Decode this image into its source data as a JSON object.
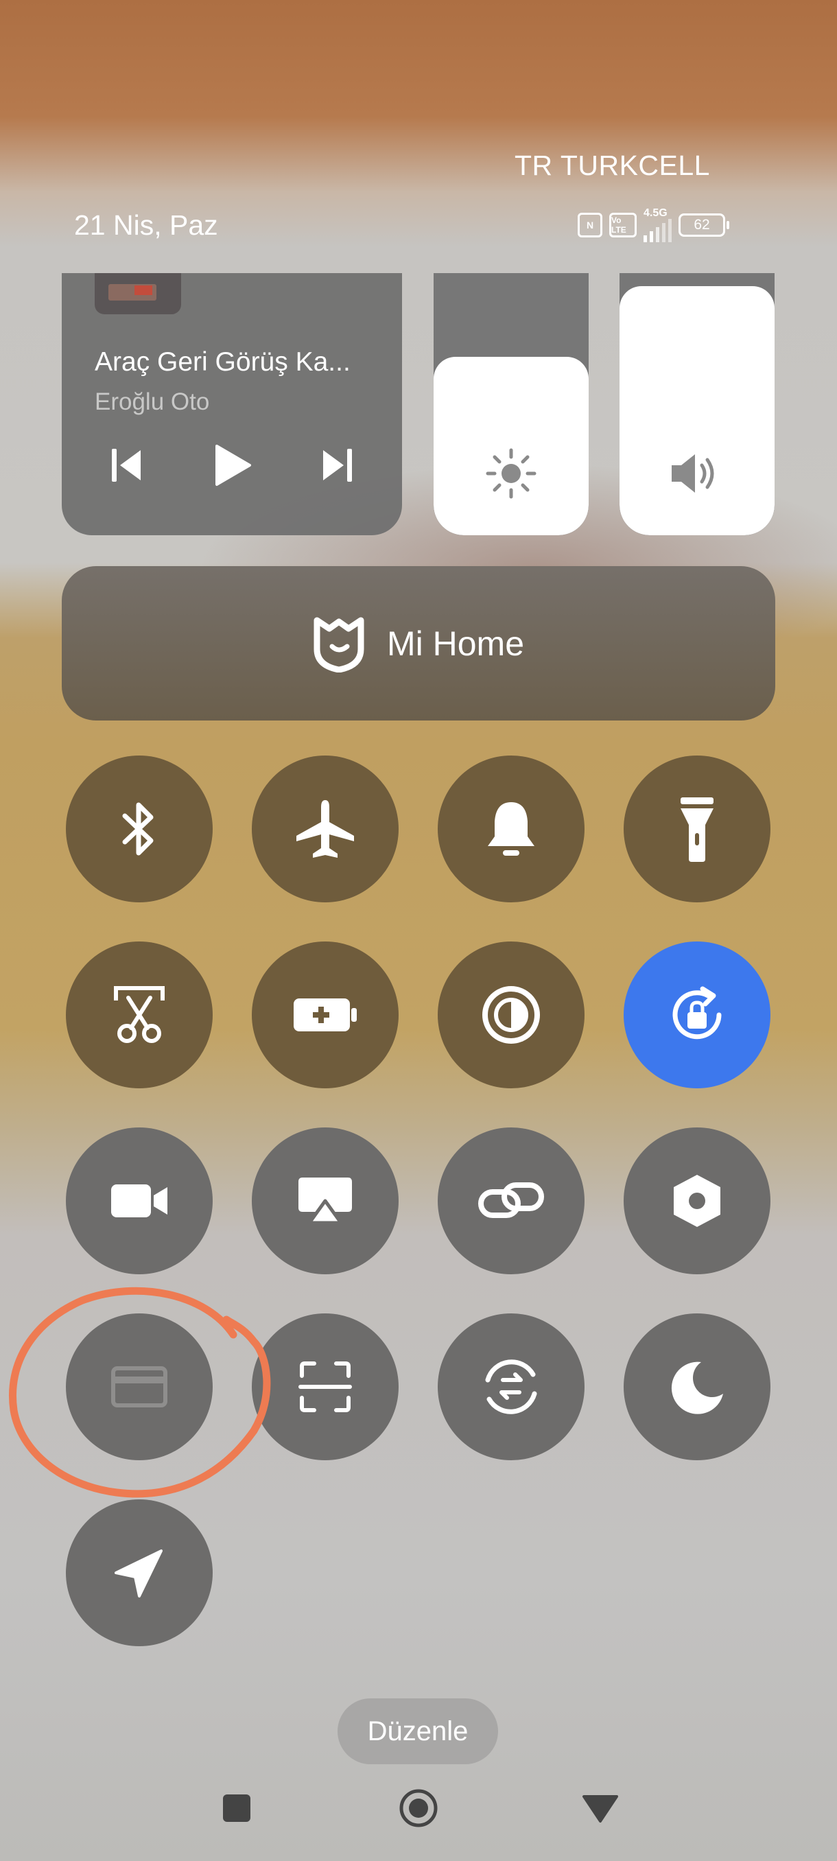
{
  "status_bar": {
    "carrier": "TR TURKCELL",
    "date": "21 Nis, Paz",
    "network": "4.5G",
    "volte": "Vo LTE",
    "battery": "62"
  },
  "media_card": {
    "title": "Araç Geri Görüş Ka...",
    "subtitle": "Eroğlu Oto",
    "controls": [
      "previous-icon",
      "play-icon",
      "next-icon"
    ]
  },
  "sliders": {
    "brightness_level": 0.68,
    "volume_level": 0.95
  },
  "mi_home": {
    "label": "Mi Home"
  },
  "tiles": [
    {
      "icon": "bluetooth-icon",
      "state": "off"
    },
    {
      "icon": "airplane-icon",
      "state": "off"
    },
    {
      "icon": "bell-icon",
      "state": "off"
    },
    {
      "icon": "flashlight-icon",
      "state": "off"
    },
    {
      "icon": "screenshot-scissors-icon",
      "state": "off"
    },
    {
      "icon": "battery-saver-icon",
      "state": "off"
    },
    {
      "icon": "contrast-icon",
      "state": "off"
    },
    {
      "icon": "rotation-lock-icon",
      "state": "on"
    },
    {
      "icon": "video-camera-icon",
      "state": "off"
    },
    {
      "icon": "cast-icon",
      "state": "off"
    },
    {
      "icon": "link-icon",
      "state": "off"
    },
    {
      "icon": "settings-hexagon-icon",
      "state": "off"
    },
    {
      "icon": "card-icon",
      "state": "disabled"
    },
    {
      "icon": "scan-icon",
      "state": "off"
    },
    {
      "icon": "sync-icon",
      "state": "off"
    },
    {
      "icon": "moon-icon",
      "state": "off"
    },
    {
      "icon": "location-icon",
      "state": "off"
    }
  ],
  "edit_button": {
    "label": "Düzenle"
  },
  "colors": {
    "active_tile": "#3d78ed",
    "annotation": "#ee7b52"
  }
}
